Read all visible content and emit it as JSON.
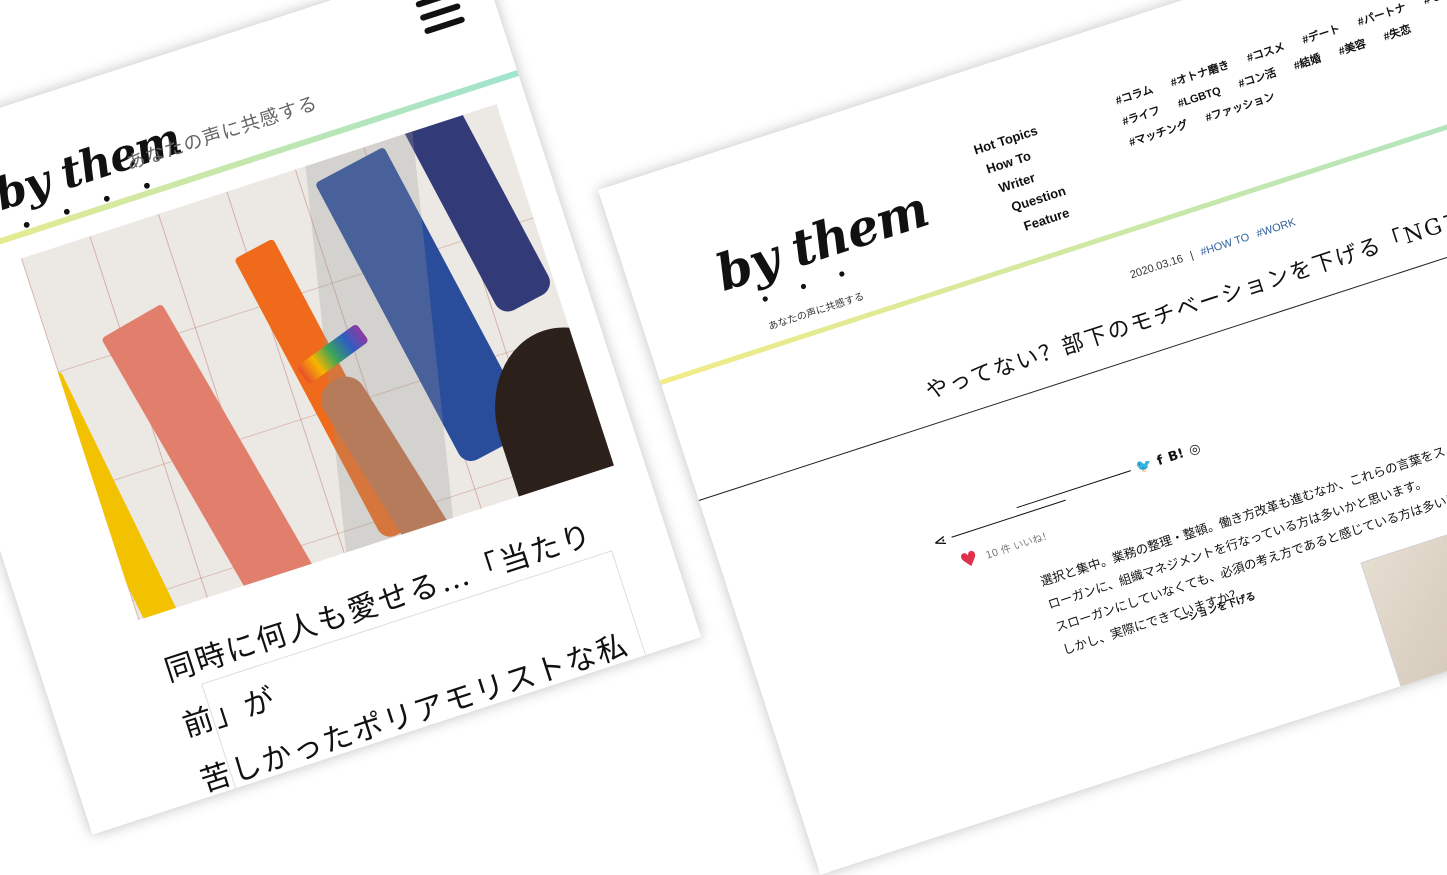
{
  "mobile": {
    "logo": "by them",
    "logo_dots": "• • • •",
    "tagline": "あなたの声に共感する",
    "headline_line1": "同時に何人も愛せる…「当たり前」が",
    "headline_line2": "苦しかったポリアモリストな私"
  },
  "desktop": {
    "logo": "by them",
    "logo_dots": "• • •",
    "tagline": "あなたの声に共感する",
    "nav": [
      "Hot Topics",
      "How To",
      "Writer",
      "Question",
      "Feature"
    ],
    "tags": [
      "#コラム",
      "#オトナ磨き",
      "#コスメ",
      "#デート",
      "#パートナ",
      "#モテ",
      "#ライフ",
      "#LGBTQ",
      "#コン活",
      "#結婚",
      "#美容",
      "#失恋",
      "#マッチング",
      "#ファッション"
    ],
    "article": {
      "date": "2020.03.16",
      "separator": "|",
      "tag1": "#HOW TO",
      "tag2": "#WORK",
      "title": "やってない？部下のモチベーションを下げる「NGマネジメント」",
      "likes": "10 件 いいね！",
      "body_line1": "選択と集中。業務の整理・整頓。働き方改革も進むなか、これらの言葉をス",
      "body_line2": "ローガンに、組織マネジメントを行なっている方は多いかと思います。",
      "body_line3": "スローガンにしていなくても、必須の考え方であると感じている方は多いは",
      "body_line4": "しかし、実際にできていますか？",
      "subhead": "ーションを下げる"
    },
    "share_icons": {
      "twitter": "🐦",
      "facebook": "f",
      "hatena": "B!",
      "line": "◎",
      "share": "⋖"
    }
  }
}
